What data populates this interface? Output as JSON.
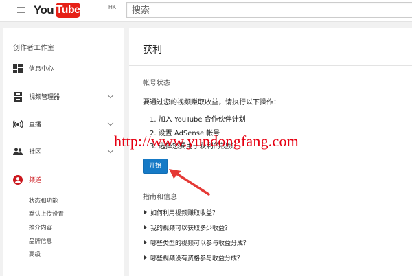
{
  "header": {
    "logo_you": "You",
    "logo_tube": "Tube",
    "logo_region": "HK",
    "search_placeholder": "搜索"
  },
  "sidebar": {
    "title": "创作者工作室",
    "items": [
      {
        "label": "信息中心",
        "icon": "dashboard-icon",
        "expandable": false
      },
      {
        "label": "视频管理器",
        "icon": "video-manager-icon",
        "expandable": true
      },
      {
        "label": "直播",
        "icon": "live-icon",
        "expandable": true
      },
      {
        "label": "社区",
        "icon": "community-icon",
        "expandable": true
      },
      {
        "label": "频道",
        "icon": "channel-icon",
        "expandable": false,
        "active": true
      }
    ],
    "channel_subitems": [
      "状态和功能",
      "默认上传设置",
      "推介内容",
      "品牌信息",
      "高级"
    ]
  },
  "main": {
    "title": "获利",
    "account_status_heading": "帐号状态",
    "intro": "要通过您的视频赚取收益，请执行以下操作：",
    "steps": [
      "1. 加入 YouTube 合作伙伴计划",
      "2. 设置 AdSense 帐号",
      "3. 选择您要用于获利的视频"
    ],
    "start_button": "开始",
    "guide_heading": "指南和信息",
    "guide_links": [
      "如何利用视频赚取收益？",
      "我的视频可以获取多少收益？",
      "哪些类型的视频可以参与收益分成？",
      "哪些视频没有资格参与收益分成？"
    ]
  },
  "overlay": {
    "watermark": "http://www.yundongfang.com",
    "watermark_color": "#e60012",
    "arrow_color": "#e53935"
  },
  "colors": {
    "brand_red": "#e62117",
    "active_red": "#cc181e",
    "button_blue": "#167ac6"
  }
}
